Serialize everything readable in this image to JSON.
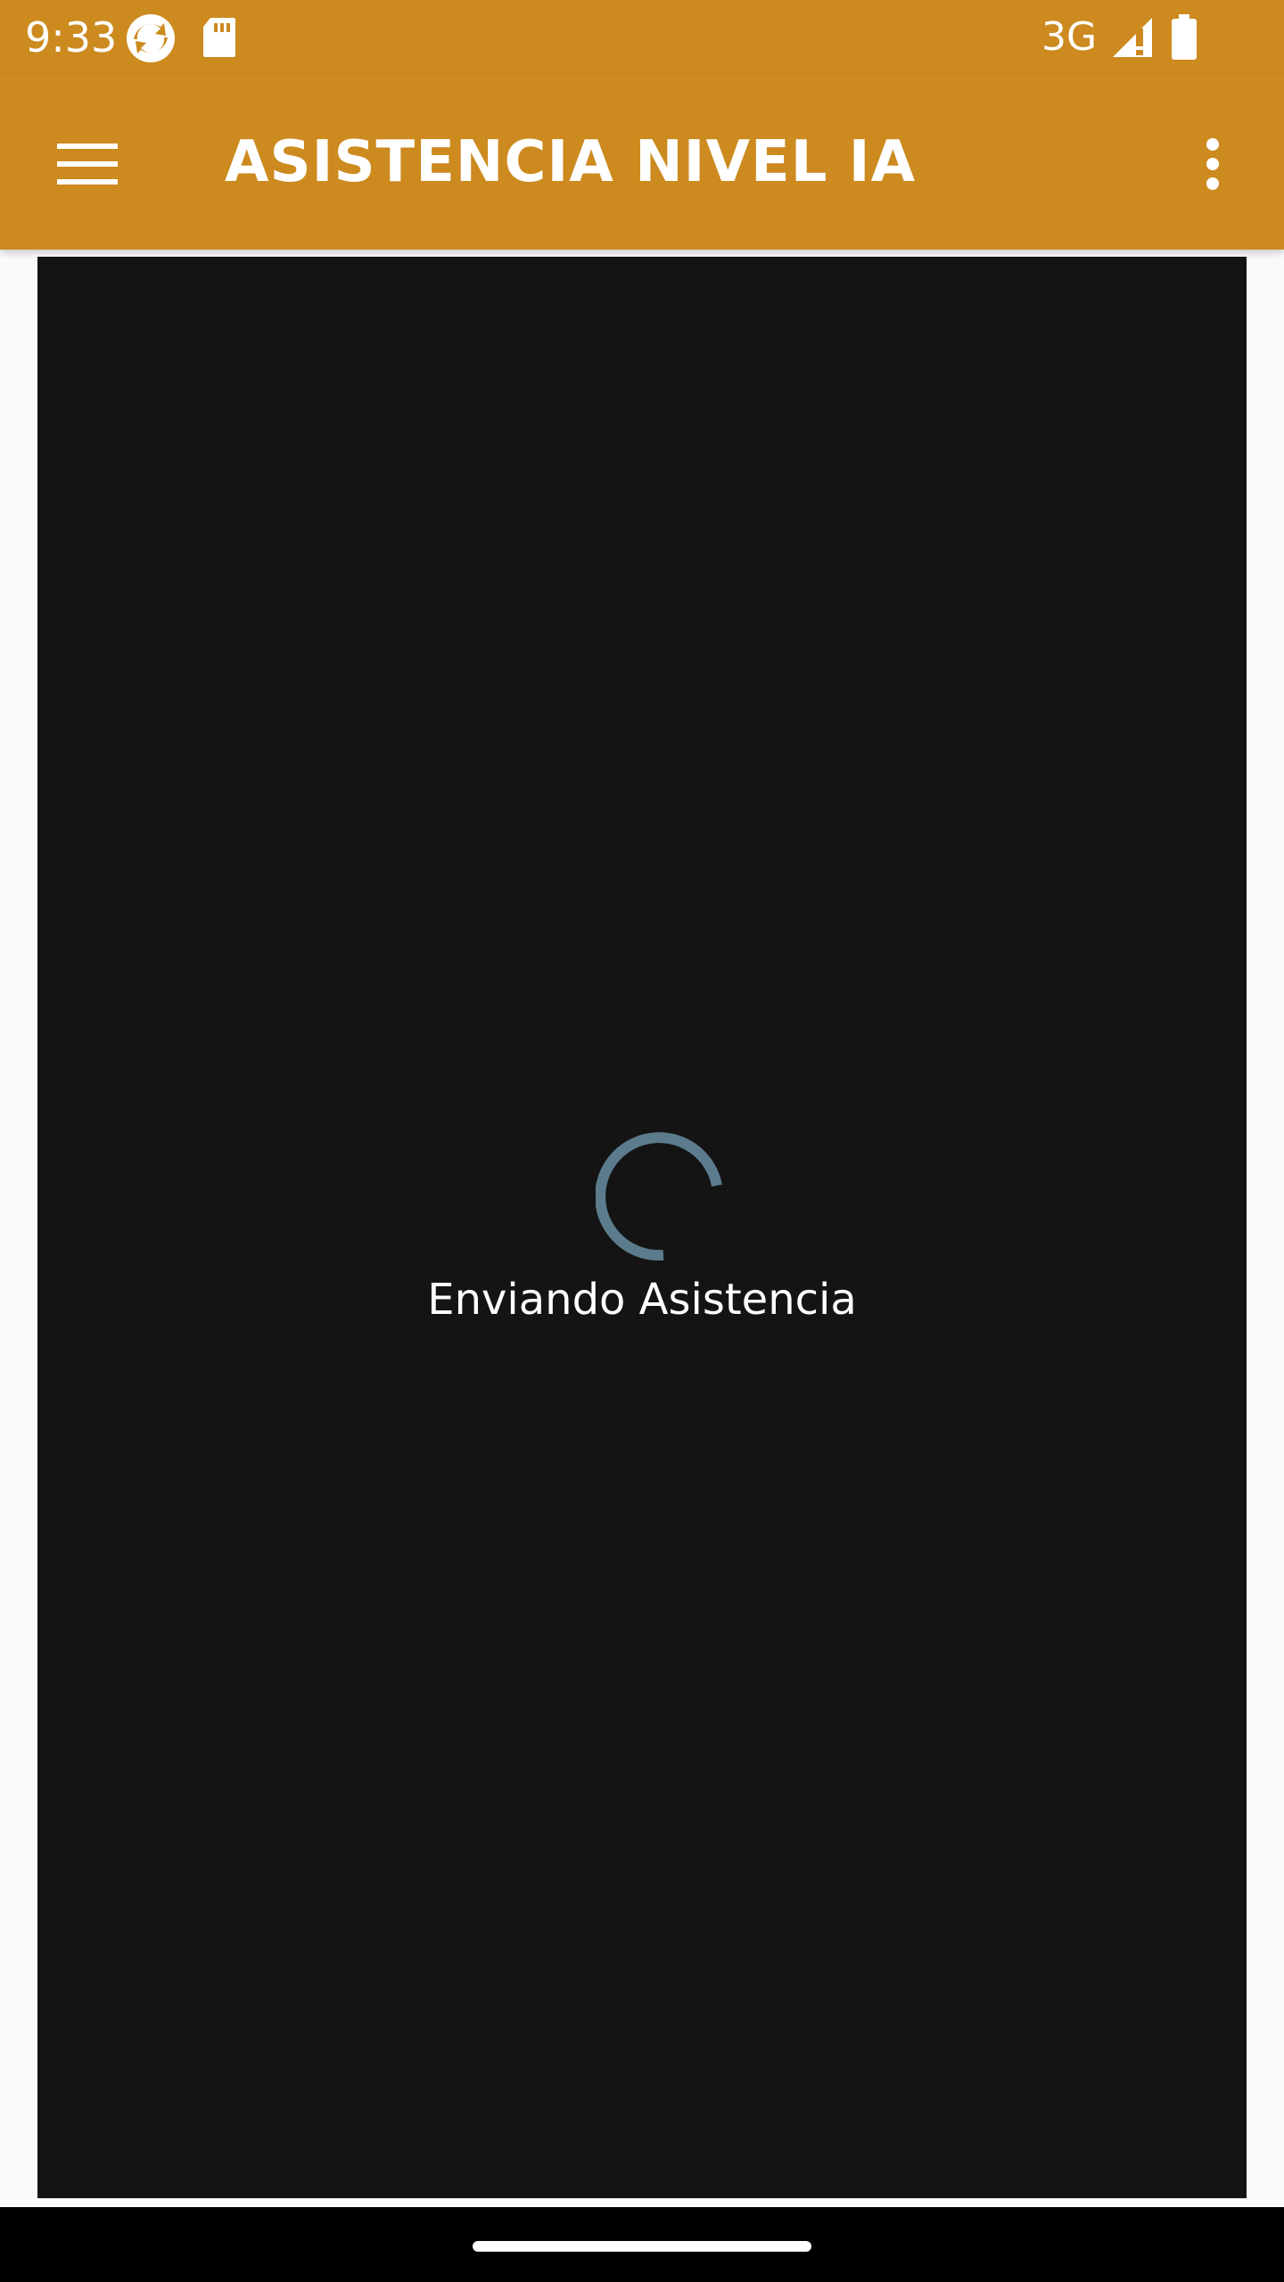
{
  "status_bar": {
    "time": "9:33",
    "network": "3G",
    "icons": [
      "sync-app-icon",
      "sd-card-icon",
      "signal-icon",
      "battery-icon"
    ]
  },
  "app_bar": {
    "title": "ASISTENCIA NIVEL IA",
    "menu_icon": "hamburger-menu-icon",
    "overflow_icon": "more-vert-icon"
  },
  "content": {
    "loading_text": "Enviando Asistencia"
  },
  "colors": {
    "accent": "#CC8A1F",
    "panel": "#141414",
    "spinner": "#5C7B8C",
    "background": "#FAFAFA"
  }
}
